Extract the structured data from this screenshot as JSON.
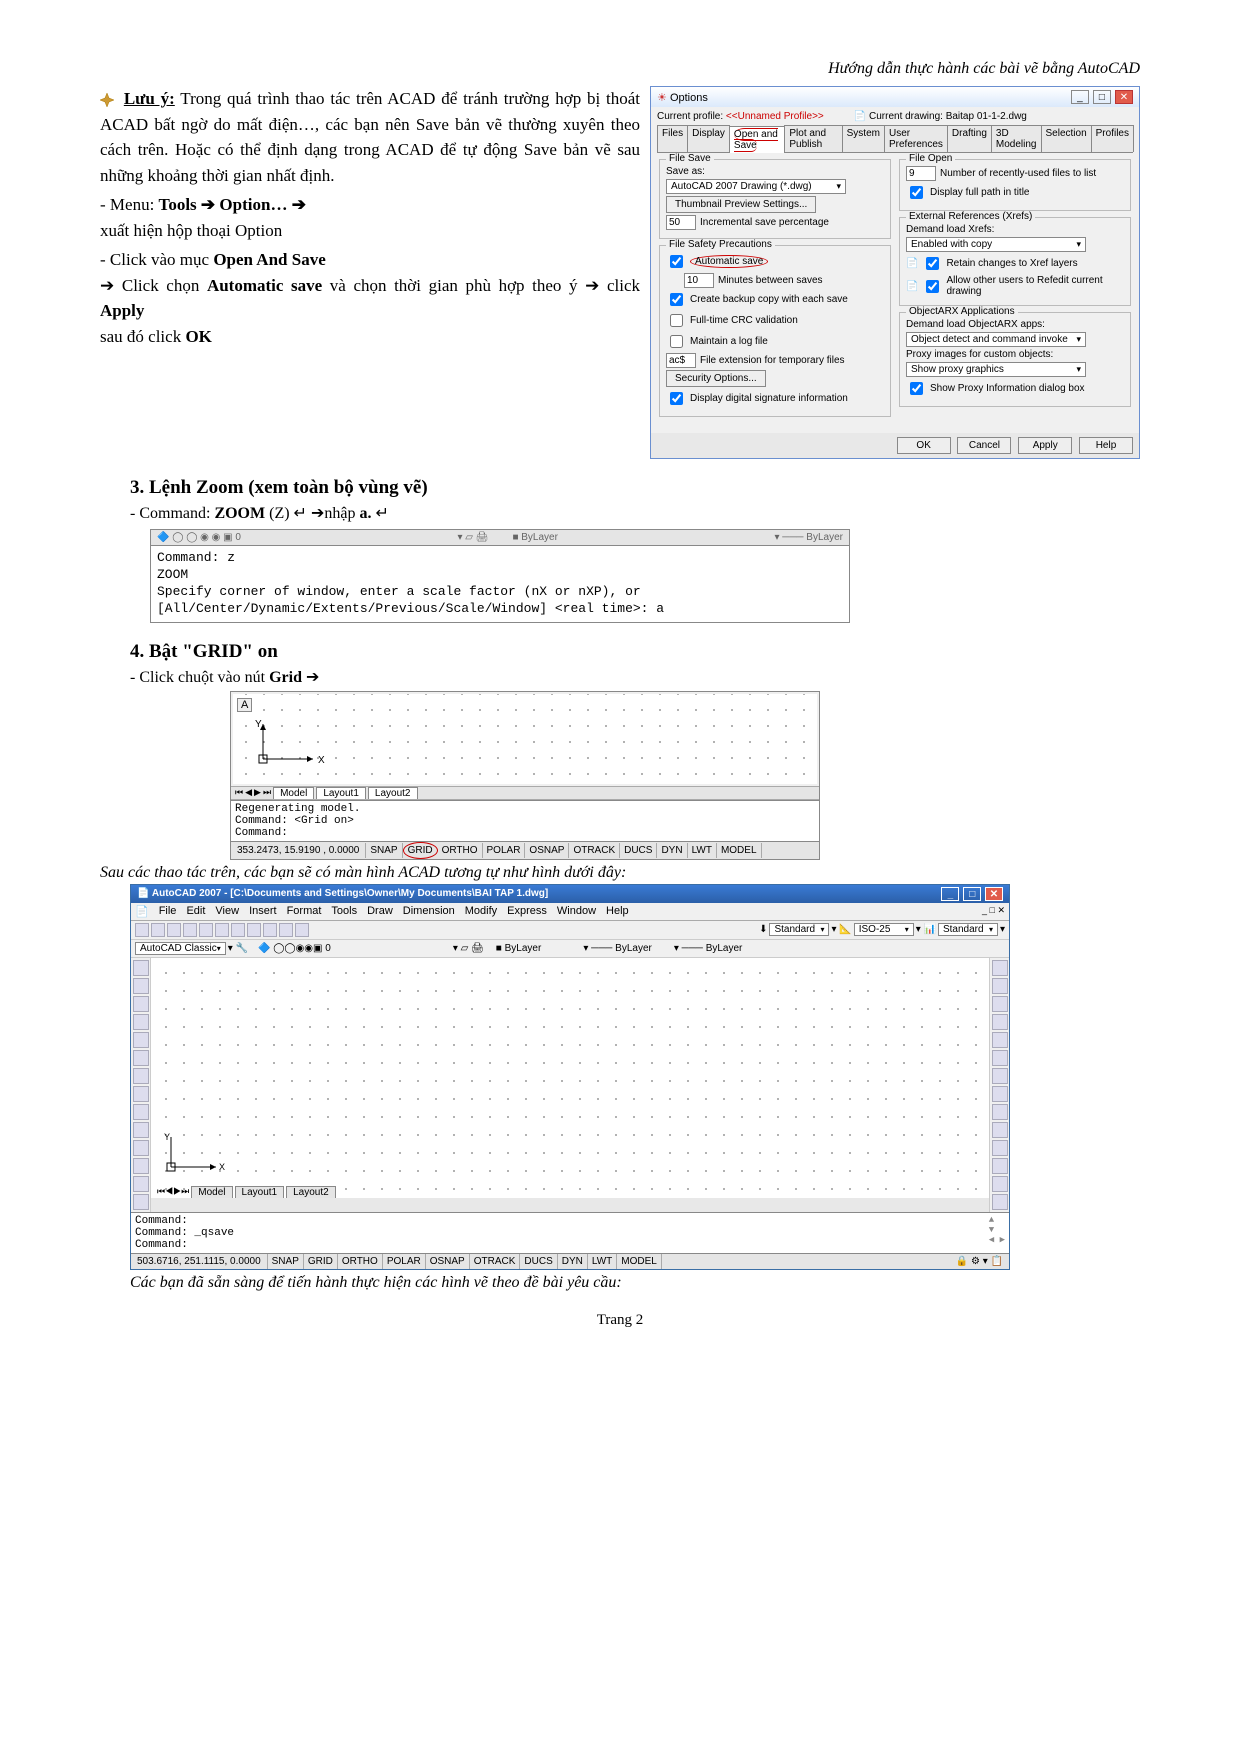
{
  "header": {
    "note": "Hướng dẫn thực hành các bài vẽ bằng AutoCAD"
  },
  "para1": {
    "luu_y": "Lưu ý:",
    "text": "Trong quá trình thao tác trên ACAD để tránh trường hợp bị thoát ACAD bất ngờ do mất điện…, các bạn nên Save bản vẽ thường xuyên theo cách trên. Hoặc có thể định dạng trong ACAD để tự động Save bản vẽ sau những khoảng thời gian nhất định."
  },
  "menu_line": {
    "prefix": "-    Menu: ",
    "tools": "Tools",
    "arrow": "➔",
    "option": "Option…",
    "tail": "xuất hiện hộp thoại Option"
  },
  "click_line": {
    "p1": "-    Click vào mục ",
    "open_save": "Open And Save",
    "p2": " Click chọn ",
    "auto": "Automatic save",
    "p3": " và chọn thời gian phù hợp theo ý ",
    "apply": "Apply",
    "p4": " sau đó click ",
    "ok": "OK"
  },
  "options": {
    "title": "Options",
    "profile_lbl": "Current profile:",
    "profile_val": "<<Unnamed Profile>>",
    "drawing_lbl": "Current drawing:",
    "drawing_val": "Baitap 01-1-2.dwg",
    "tabs": [
      "Files",
      "Display",
      "Open and Save",
      "Plot and Publish",
      "System",
      "User Preferences",
      "Drafting",
      "3D Modeling",
      "Selection",
      "Profiles"
    ],
    "file_save": "File Save",
    "save_as": "Save as:",
    "save_fmt": "AutoCAD 2007 Drawing (*.dwg)",
    "thumb_btn": "Thumbnail Preview Settings...",
    "isp_val": "50",
    "isp_lbl": "Incremental save percentage",
    "safety": "File Safety Precautions",
    "auto_save": "Automatic save",
    "mins_val": "10",
    "mins_lbl": "Minutes between saves",
    "backup": "Create backup copy with each save",
    "crc": "Full-time CRC validation",
    "log": "Maintain a log file",
    "ext_val": "ac$",
    "ext_lbl": "File extension for temporary files",
    "sec_btn": "Security Options...",
    "sig": "Display digital signature information",
    "file_open": "File Open",
    "recent_val": "9",
    "recent_lbl": "Number of recently-used files to list",
    "full_path": "Display full path in title",
    "xrefs": "External References (Xrefs)",
    "demand": "Demand load Xrefs:",
    "demand_val": "Enabled with copy",
    "retain": "Retain changes to Xref layers",
    "allow": "Allow other users to Refedit current drawing",
    "arx": "ObjectARX Applications",
    "arx_demand": "Demand load ObjectARX apps:",
    "arx_val": "Object detect and command invoke",
    "proxy": "Proxy images for custom objects:",
    "proxy_val": "Show proxy graphics",
    "show_proxy": "Show Proxy Information dialog box",
    "btn_ok": "OK",
    "btn_cancel": "Cancel",
    "btn_apply": "Apply",
    "btn_help": "Help"
  },
  "h3_zoom": "3.  Lệnh Zoom (xem toàn bộ vùng vẽ)",
  "zoom_bullet": {
    "p1": "-    Command: ",
    "cmd": "ZOOM",
    "p2": " (Z) ↵ ➔nhập ",
    "a": "a.",
    "enter": "↵"
  },
  "zoom_window": {
    "toolbar": "ByLayer",
    "toolbar2": "ByLayer",
    "line1": "Command: z",
    "line2": "ZOOM",
    "line3": "Specify corner of window, enter a scale factor (nX or nXP), or",
    "line4": "[All/Center/Dynamic/Extents/Previous/Scale/Window] <real time>: a"
  },
  "h3_grid": "4.  Bật \"GRID\" on",
  "grid_bullet": {
    "p1": "-    Click chuột vào nút ",
    "grid": "Grid",
    "arr": "➔"
  },
  "grid_box": {
    "model": "Model",
    "layout1": "Layout1",
    "layout2": "Layout2",
    "cmd1": "Regenerating model.",
    "cmd2": "Command:  <Grid on>",
    "cmd3": "Command:",
    "coords": "353.2473, 15.9190 , 0.0000",
    "buttons": [
      "SNAP",
      "GRID",
      "ORTHO",
      "POLAR",
      "OSNAP",
      "OTRACK",
      "DUCS",
      "DYN",
      "LWT",
      "MODEL"
    ]
  },
  "caption1": "Sau các thao tác trên, các bạn sẽ có màn hình ACAD tương tự như hình dưới đây:",
  "acad": {
    "title": "AutoCAD 2007 - [C:\\Documents and Settings\\Owner\\My Documents\\BAI TAP 1.dwg]",
    "menus": [
      "File",
      "Edit",
      "View",
      "Insert",
      "Format",
      "Tools",
      "Draw",
      "Dimension",
      "Modify",
      "Express",
      "Window",
      "Help"
    ],
    "ws": "AutoCAD Classic",
    "std": "Standard",
    "iso": "ISO-25",
    "std2": "Standard",
    "bylayer": "ByLayer",
    "model": "Model",
    "layout1": "Layout1",
    "layout2": "Layout2",
    "cmd1": "Command:",
    "cmd2": "Command: _qsave",
    "cmd3": "Command:",
    "coords": "503.6716, 251.1115, 0.0000",
    "buttons": [
      "SNAP",
      "GRID",
      "ORTHO",
      "POLAR",
      "OSNAP",
      "OTRACK",
      "DUCS",
      "DYN",
      "LWT",
      "MODEL"
    ]
  },
  "caption2": "Các bạn đã sẵn sàng để tiến hành thực hiện các hình vẽ theo đề bài yêu cầu:",
  "page": "Trang 2"
}
